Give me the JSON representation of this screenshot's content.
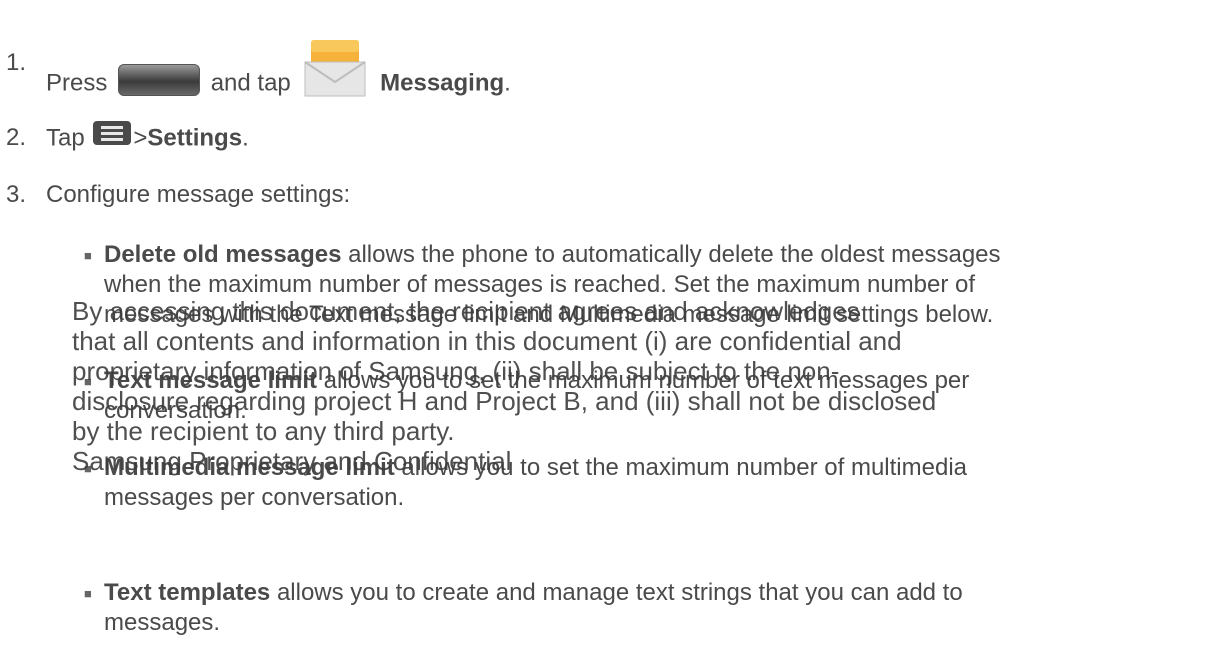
{
  "steps": {
    "s1": {
      "num": "1.",
      "press": "Press",
      "and_tap": "and tap",
      "messaging": "Messaging",
      "period": "."
    },
    "s2": {
      "num": "2.",
      "tap": "Tap",
      "gt": ">",
      "settings": "Settings",
      "period": "."
    },
    "s3": {
      "num": "3.",
      "text": "Configure message settings:"
    }
  },
  "bullets": [
    {
      "title": "Delete old messages",
      "line1": " allows the phone to automatically delete the oldest messages",
      "line2": "when the maximum number of messages is reached. Set the maximum number of",
      "line3": "messages with the Text message limit and Multimedia message limit settings below."
    },
    {
      "title": "Text message limit",
      "line1": " allows you to set the maximum number of text messages per",
      "line2": "conversation."
    },
    {
      "title": "Multimedia message limit",
      "line1": " allows you to set the maximum number of multimedia",
      "line2": "messages per conversation."
    },
    {
      "title": "Text templates",
      "line1": " allows you to create and manage text strings that you can add to",
      "line2": "messages."
    }
  ],
  "watermark": {
    "line1": "By accessing this document, the recipient agrees and acknowledges",
    "line2": "that all contents and information in this document (i) are confidential and",
    "line3": "proprietary information of Samsung, (ii) shall be subject to the non-",
    "line4": "disclosure regarding project H and Project B, and (iii) shall not be disclosed",
    "line5": "by the recipient to any third party.",
    "line6": "Samsung Proprietary and Confidential"
  },
  "icons": {
    "home_key": "home-key-icon",
    "messaging": "messaging-envelope-icon",
    "menu_key": "menu-key-icon"
  },
  "colors": {
    "text": "#4a4a4a",
    "envelope": "#f5a623"
  }
}
